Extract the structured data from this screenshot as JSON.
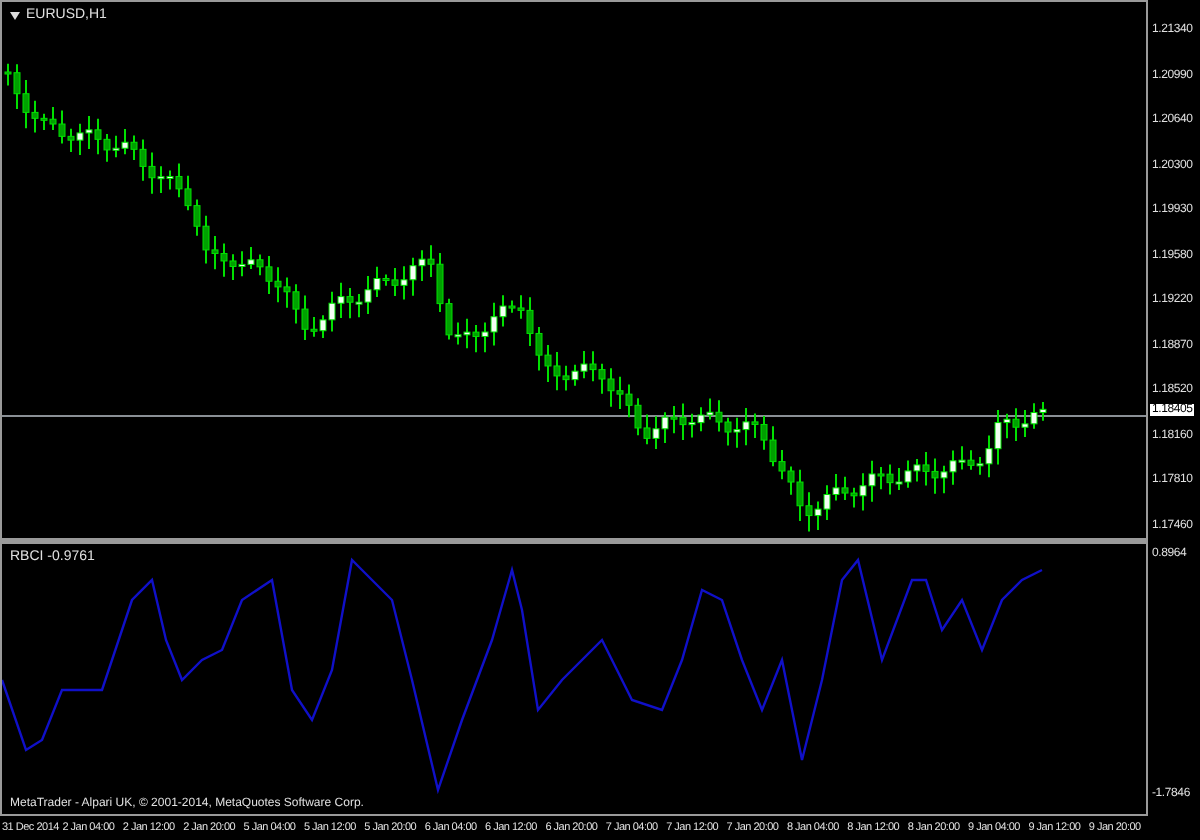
{
  "main_pane": {
    "title": "EURUSD,H1",
    "price_labels": [
      "1.21340",
      "1.20990",
      "1.20640",
      "1.20300",
      "1.19930",
      "1.19580",
      "1.19220",
      "1.18870",
      "1.18520",
      "1.18160",
      "1.17810",
      "1.17460"
    ],
    "current_price": "1.18405"
  },
  "indicator_pane": {
    "title": "RBCI -0.9761",
    "scale_labels": [
      "0.8964",
      "-1.7846"
    ],
    "copyright": "MetaTrader - Alpari UK, © 2001-2014, MetaQuotes Software Corp."
  },
  "time_axis": [
    "31 Dec 2014",
    "2 Jan 04:00",
    "2 Jan 12:00",
    "2 Jan 20:00",
    "5 Jan 04:00",
    "5 Jan 12:00",
    "5 Jan 20:00",
    "6 Jan 04:00",
    "6 Jan 12:00",
    "6 Jan 20:00",
    "7 Jan 04:00",
    "7 Jan 12:00",
    "7 Jan 20:00",
    "8 Jan 04:00",
    "8 Jan 12:00",
    "8 Jan 20:00",
    "9 Jan 04:00",
    "9 Jan 12:00",
    "9 Jan 20:00"
  ]
}
